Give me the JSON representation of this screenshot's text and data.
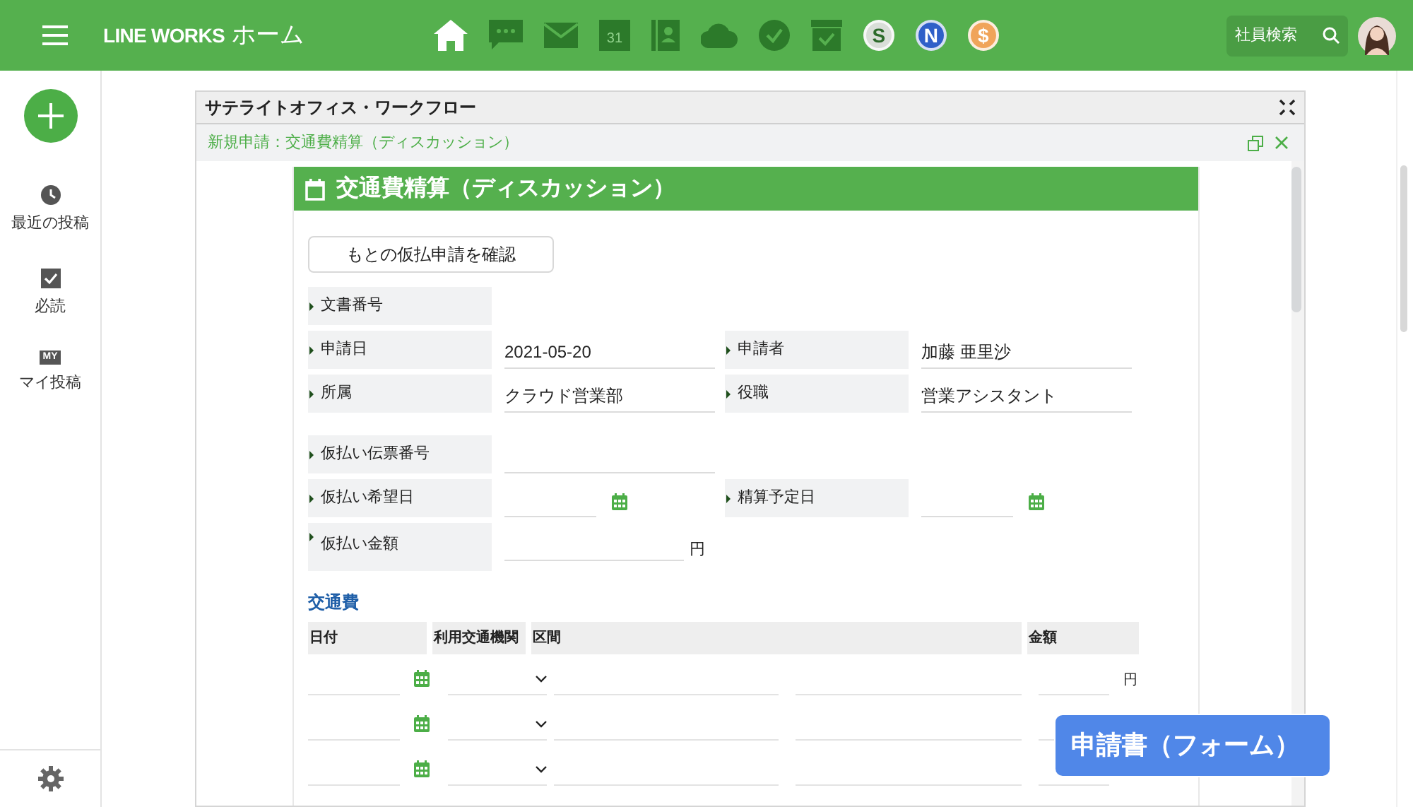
{
  "topbar": {
    "brand": "LINE WORKS",
    "title": "ホーム",
    "apps": [
      {
        "kind": "home"
      },
      {
        "kind": "chat"
      },
      {
        "kind": "mail"
      },
      {
        "kind": "calendar",
        "text": "31"
      },
      {
        "kind": "contacts"
      },
      {
        "kind": "cloud"
      },
      {
        "kind": "task"
      },
      {
        "kind": "box"
      },
      {
        "kind": "emblem",
        "text": "S",
        "color": "#d9ded8"
      },
      {
        "kind": "emblem",
        "text": "N",
        "color": "#2f5fc8"
      },
      {
        "kind": "emblem",
        "text": "$",
        "color": "#f0a45a"
      }
    ],
    "search": {
      "label": "社員検索"
    }
  },
  "sidebar": {
    "items": [
      {
        "kind": "recent",
        "label": "最近の投稿"
      },
      {
        "kind": "required",
        "label": "必読"
      },
      {
        "kind": "mine",
        "icon_text": "MY",
        "label": "マイ投稿"
      }
    ]
  },
  "panel": {
    "title": "サテライトオフィス・ワークフロー",
    "subtitle": "新規申請：交通費精算（ディスカッション）",
    "form": {
      "title": "交通費精算（ディスカッション）",
      "button": "もとの仮払申請を確認",
      "groups": [
        [
          [
            {
              "label": "文書番号",
              "kind": "none"
            }
          ],
          [
            {
              "label": "申請日",
              "kind": "text",
              "value": "2021-05-20"
            },
            {
              "label": "申請者",
              "kind": "text",
              "value": "加藤 亜里沙"
            }
          ],
          [
            {
              "label": "所属",
              "kind": "text",
              "value": "クラウド営業部"
            },
            {
              "label": "役職",
              "kind": "text",
              "value": "営業アシスタント"
            }
          ]
        ],
        [
          [
            {
              "label": "仮払い伝票番号",
              "kind": "text"
            }
          ],
          [
            {
              "label": "仮払い希望日",
              "kind": "date"
            },
            {
              "label": "精算予定日",
              "kind": "date"
            }
          ],
          [
            {
              "label": "仮払い金額",
              "kind": "amount",
              "unit": "円"
            }
          ]
        ]
      ],
      "section": "交通費",
      "table": {
        "columns": [
          "日付",
          "利用交通機関",
          "区間",
          "金額"
        ],
        "rows": [
          {
            "unit": "円"
          },
          {},
          {}
        ]
      }
    },
    "badge": "申請書（フォーム）"
  }
}
